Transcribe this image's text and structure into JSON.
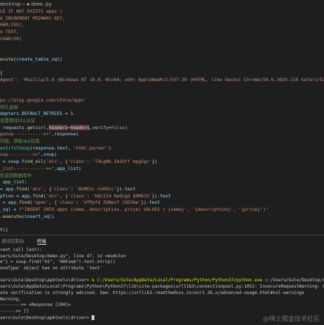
{
  "breadcrumb": {
    "folder": "desktop",
    "separator": ">",
    "file": "demo.py"
  },
  "editor_lines": [
    [
      {
        "t": "LE IF NOT EXISTS apps (",
        "c": "str"
      }
    ],
    [
      {
        "t": "O_INCREMENT PRIMARY KEY,",
        "c": "str"
      }
    ],
    [
      {
        "t": "HAR(255),",
        "c": "str"
      }
    ],
    [
      {
        "t": "n TEXT,",
        "c": "str"
      }
    ],
    [
      {
        "t": "CHAR(50)",
        "c": "str"
      }
    ],
    [
      {
        "t": "",
        "c": ""
      }
    ],
    [
      {
        "t": "",
        "c": ""
      }
    ],
    [
      {
        "t": "ecute",
        "c": "fn"
      },
      {
        "t": "(",
        "c": ""
      },
      {
        "t": "create_table_sql",
        "c": "var"
      },
      {
        "t": ")",
        "c": ""
      }
    ],
    [
      {
        "t": "",
        "c": ""
      }
    ],
    [
      {
        "t": "{",
        "c": ""
      }
    ],
    [
      {
        "t": "Agent': 'Mozilla/5.0 (Windows NT 10.0; Win64; x64) AppleWebKit/537.36 (KHTML, like Gecko) Chrome/58.0.3029.110 Safari/537.3'",
        "c": "str"
      },
      {
        "t": "}",
        "c": ""
      }
    ],
    [
      {
        "t": "",
        "c": ""
      }
    ],
    [
      {
        "t": "",
        "c": ""
      }
    ],
    [
      {
        "t": "ps://play.google.com/store/apps'",
        "c": "str"
      }
    ],
    [
      {
        "t": "待久连接",
        "c": "cmt"
      }
    ],
    [
      {
        "t": "dapters",
        "c": "var"
      },
      {
        "t": ".",
        "c": ""
      },
      {
        "t": "DEFAULT_RETRIES",
        "c": "var"
      },
      {
        "t": " = ",
        "c": ""
      },
      {
        "t": "5",
        "c": "num"
      }
    ],
    [
      {
        "t": "设置移除SSL认证",
        "c": "cmt"
      }
    ],
    [
      {
        "t": " requests",
        "c": "var"
      },
      {
        "t": ".",
        "c": ""
      },
      {
        "t": "get",
        "c": "fn"
      },
      {
        "t": "(",
        "c": ""
      },
      {
        "t": "url",
        "c": "var"
      },
      {
        "t": ",",
        "c": ""
      },
      {
        "t": "headers",
        "c": "hl"
      },
      {
        "t": "=",
        "c": ""
      },
      {
        "t": "headers",
        "c": "hl"
      },
      {
        "t": ",",
        "c": ""
      },
      {
        "t": "verify",
        "c": "var"
      },
      {
        "t": "=",
        "c": ""
      },
      {
        "t": "False",
        "c": "kw"
      },
      {
        "t": ")",
        "c": ""
      }
    ],
    [
      {
        "t": "ponse----------->>\"",
        "c": "str"
      },
      {
        "t": ",",
        "c": ""
      },
      {
        "t": "response",
        "c": "var"
      },
      {
        "t": ")",
        "c": ""
      }
    ],
    [
      {
        "t": "内容，获取app信息",
        "c": "cmt"
      }
    ],
    [
      {
        "t": "autifulSoup",
        "c": "cls"
      },
      {
        "t": "(",
        "c": ""
      },
      {
        "t": "response",
        "c": "var"
      },
      {
        "t": ".",
        "c": ""
      },
      {
        "t": "text",
        "c": "var"
      },
      {
        "t": ", ",
        "c": ""
      },
      {
        "t": "'html.parser'",
        "c": "str"
      },
      {
        "t": ")",
        "c": ""
      }
    ],
    [
      {
        "t": "oup--------->>\"",
        "c": "str"
      },
      {
        "t": ",",
        "c": ""
      },
      {
        "t": "soup",
        "c": "var"
      },
      {
        "t": ")",
        "c": ""
      }
    ],
    [
      {
        "t": " = ",
        "c": ""
      },
      {
        "t": "soup",
        "c": "var"
      },
      {
        "t": ".",
        "c": ""
      },
      {
        "t": "find_all",
        "c": "fn"
      },
      {
        "t": "(",
        "c": ""
      },
      {
        "t": "'div'",
        "c": "str"
      },
      {
        "t": ", {",
        "c": ""
      },
      {
        "t": "'class'",
        "c": "str"
      },
      {
        "t": ": ",
        "c": ""
      },
      {
        "t": "'T4LgNb Im2Gtf mpg5gc'",
        "c": "str"
      },
      {
        "t": "})",
        "c": ""
      }
    ],
    [
      {
        "t": "_list------------>>\"",
        "c": "str"
      },
      {
        "t": ",",
        "c": ""
      },
      {
        "t": "app_list",
        "c": "var"
      },
      {
        "t": ")",
        "c": ""
      }
    ],
    [
      {
        "t": "信息到数据库中",
        "c": "cmt"
      }
    ],
    [
      {
        "t": " app_list",
        "c": "var"
      },
      {
        "t": ":",
        "c": ""
      }
    ],
    [
      {
        "t": "= ",
        "c": ""
      },
      {
        "t": "app",
        "c": "var"
      },
      {
        "t": ".",
        "c": ""
      },
      {
        "t": "find",
        "c": "fn"
      },
      {
        "t": "(",
        "c": ""
      },
      {
        "t": "'div'",
        "c": "str"
      },
      {
        "t": ", {",
        "c": ""
      },
      {
        "t": "'class'",
        "c": "str"
      },
      {
        "t": ": ",
        "c": ""
      },
      {
        "t": "'WsMG1c nnK0zc'",
        "c": "str"
      },
      {
        "t": "}).",
        "c": ""
      },
      {
        "t": "text",
        "c": "var"
      }
    ],
    [
      {
        "t": "ption",
        "c": "var"
      },
      {
        "t": " = ",
        "c": ""
      },
      {
        "t": "app",
        "c": "var"
      },
      {
        "t": ".",
        "c": ""
      },
      {
        "t": "find",
        "c": "fn"
      },
      {
        "t": "(",
        "c": ""
      },
      {
        "t": "'div'",
        "c": "str"
      },
      {
        "t": ", {",
        "c": ""
      },
      {
        "t": "'class'",
        "c": "str"
      },
      {
        "t": ": ",
        "c": ""
      },
      {
        "t": "'b8cIId ReQCgd Q9MA7b'",
        "c": "str"
      },
      {
        "t": "}).",
        "c": ""
      },
      {
        "t": "text",
        "c": "var"
      }
    ],
    [
      {
        "t": " = ",
        "c": ""
      },
      {
        "t": "app",
        "c": "var"
      },
      {
        "t": ".",
        "c": ""
      },
      {
        "t": "find",
        "c": "fn"
      },
      {
        "t": "(",
        "c": ""
      },
      {
        "t": "'span'",
        "c": "str"
      },
      {
        "t": ", {",
        "c": ""
      },
      {
        "t": "'class'",
        "c": "str"
      },
      {
        "t": ": ",
        "c": ""
      },
      {
        "t": "'VfPpfd ZdBevf i5DZme'",
        "c": "str"
      },
      {
        "t": "}).",
        "c": ""
      },
      {
        "t": "text",
        "c": "var"
      }
    ],
    [
      {
        "t": "_sql",
        "c": "var"
      },
      {
        "t": " = ",
        "c": ""
      },
      {
        "t": "f",
        "c": "kw"
      },
      {
        "t": "\"INSERT INTO apps (name, description, price) VALUES ('{name}', '{description}', '{price}')\"",
        "c": "str"
      }
    ],
    [
      {
        "t": ".",
        "c": ""
      },
      {
        "t": "execute",
        "c": "fn"
      },
      {
        "t": "(",
        "c": ""
      },
      {
        "t": "insert_sql",
        "c": "var"
      },
      {
        "t": ")",
        "c": ""
      }
    ],
    [
      {
        "t": "",
        "c": ""
      }
    ],
    [
      {
        "t": "t()",
        "c": "fn"
      }
    ],
    [
      {
        "t": "ose()",
        "c": "fn"
      }
    ],
    [
      {
        "t": "()",
        "c": "fn"
      }
    ]
  ],
  "panel": {
    "tabs": [
      "调试控制台",
      "终端"
    ],
    "active_tab": 1
  },
  "terminal_lines": [
    [
      {
        "t": "cent call last):",
        "c": ""
      }
    ],
    [
      {
        "t": "sers/Gule/Desktop/demo.py\", line 47, in <module>",
        "c": ""
      }
    ],
    [
      {
        "t": "e\"} = soup.find(\"h1\", \"AHFaub\").text.strip()",
        "c": ""
      }
    ],
    [
      {
        "t": "oneType' object has no attribute 'text'",
        "c": ""
      }
    ],
    [
      {
        "t": "",
        "c": ""
      }
    ],
    [
      {
        "t": "sers\\Gule\\Desktop\\apktools\\driver> ",
        "c": ""
      },
      {
        "t": "& C:/Users/Gule/AppData/Local/Programs/Python/Python37/python.exe",
        "c": "yellow"
      },
      {
        "t": " c:/Users/Gule/Desktop/demo.py",
        "c": ""
      }
    ],
    [
      {
        "t": "sers\\Gule\\AppData\\Local\\Programs\\Python\\Python37\\lib\\site-packages\\urllib3\\connectionpool.py:1052: InsecureRequestWarning: Unverified HTTPS request is b",
        "c": ""
      }
    ],
    [
      {
        "t": "ate verification is strongly advised. See: https://urllib3.readthedocs.io/en/1.26.x/advanced-usage.html#ssl-warnings",
        "c": ""
      }
    ],
    [
      {
        "t": "Warning,",
        "c": ""
      }
    ],
    [
      {
        "t": "-------->> <Response [200]>",
        "c": ""
      }
    ],
    [
      {
        "t": "------>> []",
        "c": ""
      }
    ],
    [
      {
        "t": "sers\\Gule\\Desktop\\apktools\\driver> ",
        "c": ""
      },
      {
        "t": "",
        "c": "cursor"
      }
    ]
  ],
  "watermark": "@稀土掘金技术社区"
}
